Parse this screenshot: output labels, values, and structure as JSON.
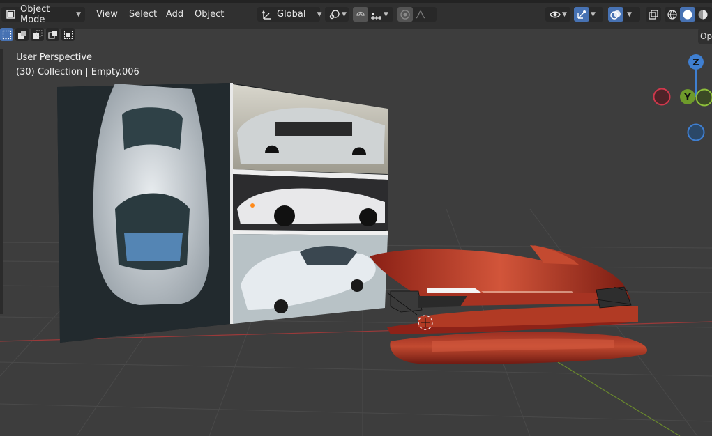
{
  "header": {
    "mode": "Object Mode",
    "menus": [
      "View",
      "Select",
      "Add",
      "Object"
    ],
    "transform_orientation": "Global",
    "option_tab": "Opt"
  },
  "viewport": {
    "view_name": "User Perspective",
    "info": "(30) Collection | Empty.006"
  },
  "gizmo": {
    "z_label": "Z",
    "y_label": "Y",
    "x_color": "#d0384c",
    "y_color": "#6e9a2b",
    "z_color": "#3f7fd1"
  },
  "icons": {
    "mode": "object-mode-icon",
    "orientation": "transform-orientation-icon",
    "pivot": "pivot-icon",
    "snap": "snap-icon",
    "increment": "increment-snap-icon",
    "proportional": "proportional-edit-icon",
    "falloff": "falloff-curve-icon",
    "visibility": "eye-icon",
    "gizmo": "gizmo-icon",
    "overlay": "overlay-icon",
    "xray": "xray-icon",
    "shading": [
      "wireframe-shading-icon",
      "solid-shading-icon",
      "material-shading-icon"
    ]
  }
}
